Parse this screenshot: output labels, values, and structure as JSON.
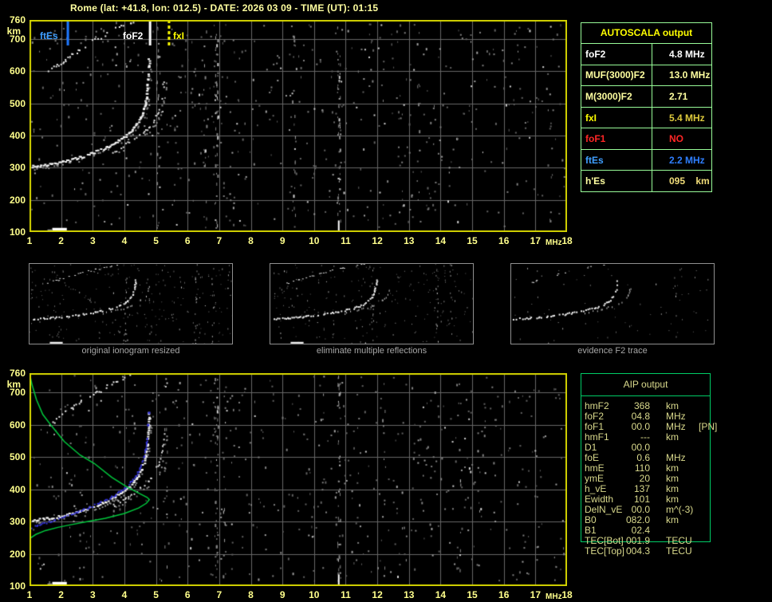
{
  "window": {
    "title": "Rome (lat: +41.8, lon: 012.5) - DATE: 2026 03 09 - TIME (UT): 01:15"
  },
  "top_plot": {
    "x_ticks": [
      1,
      2,
      3,
      4,
      5,
      6,
      7,
      8,
      9,
      10,
      11,
      12,
      13,
      14,
      15,
      16,
      17,
      18
    ],
    "x_unit": "MHz",
    "y_ticks": [
      760,
      700,
      600,
      500,
      400,
      300,
      200,
      100
    ],
    "y_unit": "km",
    "markers": [
      {
        "id": "ftEs",
        "label": "ftEs",
        "freq": 2.2,
        "line_color": "#1e78ff",
        "label_color": "#3f9fff",
        "style": "solid"
      },
      {
        "id": "foF2",
        "label": "foF2",
        "freq": 4.8,
        "line_color": "#ffffff",
        "label_color": "#ffffff",
        "style": "solid"
      },
      {
        "id": "fxI",
        "label": "fxI",
        "freq": 5.4,
        "line_color": "#ffff00",
        "label_color": "#ffff00",
        "style": "dashed"
      }
    ]
  },
  "bottom_plot": {
    "x_ticks": [
      1,
      2,
      3,
      4,
      5,
      6,
      7,
      8,
      9,
      10,
      11,
      12,
      13,
      14,
      15,
      16,
      17,
      18
    ],
    "x_unit": "MHz",
    "y_ticks": [
      760,
      700,
      600,
      500,
      400,
      300,
      200,
      100
    ],
    "y_unit": "km"
  },
  "autoscala": {
    "title": "AUTOSCALA output",
    "border_color": "#98fb98",
    "rows": [
      {
        "label": "foF2",
        "value": "4.8 MHz",
        "label_color": "#ffffff",
        "value_color": "#ffffff"
      },
      {
        "label": "MUF(3000)F2",
        "value": "13.0 MHz",
        "label_color": "#ffffa0",
        "value_color": "#ffffa0"
      },
      {
        "label": "M(3000)F2",
        "value": "2.71",
        "label_color": "#ffffa0",
        "value_color": "#ffffa0"
      },
      {
        "label": "fxI",
        "value": "5.4 MHz",
        "label_color": "#ffff00",
        "value_color": "#dcc83c"
      },
      {
        "label": "foF1",
        "value": "NO",
        "label_color": "#ff2626",
        "value_color": "#ff2626"
      },
      {
        "label": "ftEs",
        "value": "2.2 MHz",
        "label_color": "#3f9fff",
        "value_color": "#2f7fff"
      },
      {
        "label": "h'Es",
        "value": "095    km",
        "label_color": "#ffffa0",
        "value_color": "#f0dc78"
      }
    ]
  },
  "thumbnails": [
    {
      "caption": "original ionogram resized"
    },
    {
      "caption": "eliminate multiple reflections"
    },
    {
      "caption": "evidence F2 trace"
    }
  ],
  "aip": {
    "title": "AIP output",
    "border_color": "#00cc66",
    "text_color": "#d9d98c",
    "rows": [
      {
        "label": "hmF2",
        "value": "368",
        "unit": "km",
        "extra": ""
      },
      {
        "label": "foF2",
        "value": "04.8",
        "unit": "MHz",
        "extra": ""
      },
      {
        "label": "foF1",
        "value": "00.0",
        "unit": "MHz",
        "extra": "[PN]"
      },
      {
        "label": "hmF1",
        "value": "---",
        "unit": "km",
        "extra": ""
      },
      {
        "label": "D1",
        "value": "00.0",
        "unit": "",
        "extra": ""
      },
      {
        "label": "foE",
        "value": "0.6",
        "unit": "MHz",
        "extra": ""
      },
      {
        "label": "hmE",
        "value": "110",
        "unit": "km",
        "extra": ""
      },
      {
        "label": "ymE",
        "value": "20",
        "unit": "km",
        "extra": ""
      },
      {
        "label": "h_vE",
        "value": "137",
        "unit": "km",
        "extra": ""
      },
      {
        "label": "Ewidth",
        "value": "101",
        "unit": "km",
        "extra": ""
      },
      {
        "label": "DelN_vE",
        "value": "00.0",
        "unit": "m^(-3)",
        "extra": ""
      },
      {
        "label": "B0",
        "value": "082.0",
        "unit": "km",
        "extra": ""
      },
      {
        "label": "B1",
        "value": "02.4",
        "unit": "",
        "extra": ""
      },
      {
        "label": "TEC[Bot]",
        "value": "001.9",
        "unit": "TECU",
        "extra": ""
      },
      {
        "label": "TEC[Top]",
        "value": "004.3",
        "unit": "TECU",
        "extra": ""
      }
    ]
  },
  "chart_data": [
    {
      "type": "scatter",
      "title": "ionogram echo traces (virtual height vs frequency)",
      "xlabel": "MHz",
      "ylabel": "km",
      "x_range": [
        1,
        18
      ],
      "y_range": [
        100,
        760
      ],
      "grid": true,
      "f2_ordinary_trace": [
        [
          1.05,
          303
        ],
        [
          1.35,
          306
        ],
        [
          1.7,
          311
        ],
        [
          2.05,
          318
        ],
        [
          2.4,
          327
        ],
        [
          2.75,
          337
        ],
        [
          3.05,
          348
        ],
        [
          3.35,
          360
        ],
        [
          3.62,
          373
        ],
        [
          3.88,
          388
        ],
        [
          4.1,
          404
        ],
        [
          4.28,
          422
        ],
        [
          4.42,
          442
        ],
        [
          4.53,
          464
        ],
        [
          4.61,
          488
        ],
        [
          4.66,
          512
        ],
        [
          4.7,
          537
        ],
        [
          4.72,
          562
        ],
        [
          4.74,
          588
        ],
        [
          4.75,
          615
        ],
        [
          4.76,
          642
        ]
      ],
      "f2_extraordinary_trace": [
        [
          3.62,
          350
        ],
        [
          3.9,
          364
        ],
        [
          4.18,
          380
        ],
        [
          4.45,
          398
        ],
        [
          4.68,
          417
        ],
        [
          4.87,
          438
        ],
        [
          5.0,
          460
        ],
        [
          5.09,
          483
        ],
        [
          5.15,
          507
        ],
        [
          5.19,
          530
        ],
        [
          5.22,
          553
        ],
        [
          5.24,
          576
        ]
      ],
      "second_hop_trace": [
        [
          1.55,
          596
        ],
        [
          1.78,
          612
        ],
        [
          2.02,
          629
        ],
        [
          2.28,
          647
        ],
        [
          2.55,
          665
        ],
        [
          2.82,
          682
        ],
        [
          3.08,
          698
        ],
        [
          3.35,
          714
        ],
        [
          3.62,
          728
        ],
        [
          3.9,
          741
        ],
        [
          4.15,
          751
        ],
        [
          4.38,
          758
        ]
      ],
      "es_blob": {
        "f_start": 1.72,
        "f_end": 2.18,
        "km": 108
      },
      "interference_dash": {
        "f": 10.78,
        "km_start": 100,
        "km_end": 136
      },
      "noise_dots": 620,
      "interference_columns_top": [
        {
          "f": 5.05,
          "n": 26
        },
        {
          "f": 6.55,
          "n": 18
        },
        {
          "f": 6.9,
          "n": 48
        },
        {
          "f": 9.35,
          "n": 20
        },
        {
          "f": 10.78,
          "n": 52
        },
        {
          "f": 13.3,
          "n": 12
        }
      ],
      "interference_columns_bottom": [
        {
          "f": 5.3,
          "n": 14
        },
        {
          "f": 6.9,
          "n": 38
        },
        {
          "f": 7.15,
          "n": 16
        },
        {
          "f": 10.78,
          "n": 42
        },
        {
          "f": 12.2,
          "n": 12
        },
        {
          "f": 14.6,
          "n": 10
        }
      ],
      "markers": {
        "ftEs_MHz": 2.2,
        "foF2_MHz": 4.8,
        "fxI_MHz": 5.4
      }
    },
    {
      "type": "line",
      "title": "AIP electron density profile and scaled F2 trace",
      "x_range": [
        1,
        18
      ],
      "y_range": [
        100,
        760
      ],
      "green_profile": [
        [
          1.0,
          760
        ],
        [
          1.08,
          724
        ],
        [
          1.22,
          678
        ],
        [
          1.42,
          632
        ],
        [
          1.7,
          596
        ],
        [
          2.1,
          548
        ],
        [
          2.6,
          506
        ],
        [
          3.05,
          480
        ],
        [
          3.6,
          437
        ],
        [
          4.1,
          406
        ],
        [
          4.5,
          386
        ],
        [
          4.72,
          375
        ],
        [
          4.79,
          368
        ],
        [
          4.7,
          357
        ],
        [
          4.45,
          342
        ],
        [
          4.0,
          325
        ],
        [
          3.4,
          310
        ],
        [
          2.85,
          300
        ],
        [
          2.3,
          290
        ],
        [
          1.9,
          282
        ],
        [
          1.5,
          272
        ],
        [
          1.2,
          260
        ],
        [
          1.0,
          247
        ]
      ],
      "blue_scaled_trace": [
        [
          1.05,
          281
        ],
        [
          1.4,
          292
        ],
        [
          1.8,
          304
        ],
        [
          2.2,
          318
        ],
        [
          2.6,
          333
        ],
        [
          2.95,
          347
        ],
        [
          3.25,
          360
        ],
        [
          3.55,
          374
        ],
        [
          3.82,
          390
        ],
        [
          4.05,
          407
        ],
        [
          4.23,
          426
        ],
        [
          4.38,
          447
        ],
        [
          4.49,
          470
        ],
        [
          4.58,
          494
        ],
        [
          4.64,
          519
        ],
        [
          4.68,
          543
        ],
        [
          4.71,
          562
        ]
      ],
      "blue_dots": [
        [
          4.74,
          600
        ],
        [
          4.77,
          638
        ]
      ]
    }
  ]
}
